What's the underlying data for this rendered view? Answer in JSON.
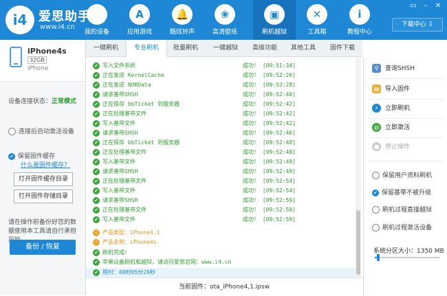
{
  "app": {
    "logo_text": "i4",
    "brand": "爱思助手",
    "url": "www.i4.cn",
    "download_center": "下载中心 ⇩"
  },
  "nav": [
    {
      "label": "我的设备",
      "icon": ""
    },
    {
      "label": "应用游戏",
      "icon": "A"
    },
    {
      "label": "酷炫铃声",
      "icon": "🔔"
    },
    {
      "label": "高清壁纸",
      "icon": "❀"
    },
    {
      "label": "刷机越狱",
      "icon": "▣"
    },
    {
      "label": "工具箱",
      "icon": "✕"
    },
    {
      "label": "教程中心",
      "icon": "i"
    }
  ],
  "device": {
    "name": "iPhone4s",
    "capacity": "32GB",
    "type": "iPhone"
  },
  "left": {
    "status_label": "设备连接状态：",
    "status_value": "正常模式",
    "auto_activate": "连接后自动激活设备",
    "keep_cache": "保留固件缓存",
    "what_cache": "什么是固件缓存？",
    "open_cache_dir": "打开固件缓存目录",
    "open_store_dir": "打开固件存储目录",
    "warning": "请在操作前备份好您的数据使用本工具请自行承担风险",
    "backup": "备份 / 恢复"
  },
  "tabs": [
    "一键刷机",
    "专业刷机",
    "批量刷机",
    "一键越狱",
    "高级功能",
    "其他工具",
    "固件下载"
  ],
  "log": [
    {
      "kind": "ok",
      "text": "写入文件系统",
      "status": "成功！ [09:51:34]"
    },
    {
      "kind": "ok",
      "text": "正在发送 KernelCache",
      "status": "成功！ [09:52:26]"
    },
    {
      "kind": "ok",
      "text": "正在发送 NORData",
      "status": "成功！ [09:52:28]"
    },
    {
      "kind": "ok",
      "text": "请求基带SHSH",
      "status": "成功！ [09:52:40]"
    },
    {
      "kind": "ok",
      "text": "正在保存 bbTicket 到服务器",
      "status": "成功！ [09:52:42]"
    },
    {
      "kind": "ok",
      "text": "正在处理基带文件",
      "status": "成功！ [09:52:42]"
    },
    {
      "kind": "ok",
      "text": "写入基带文件",
      "status": "成功！ [09:52:42]"
    },
    {
      "kind": "ok",
      "text": "请求基带SHSH",
      "status": "成功！ [09:52:46]"
    },
    {
      "kind": "ok",
      "text": "正在保存 bbTicket 到服务器",
      "status": "成功！ [09:52:48]"
    },
    {
      "kind": "ok",
      "text": "正在处理基带文件",
      "status": "成功！ [09:52:48]"
    },
    {
      "kind": "ok",
      "text": "写入基带文件",
      "status": "成功！ [09:52:49]"
    },
    {
      "kind": "ok",
      "text": "请求基带SHSH",
      "status": "成功！ [09:52:49]"
    },
    {
      "kind": "ok",
      "text": "正在处理基带文件",
      "status": "成功！ [09:52:54]"
    },
    {
      "kind": "ok",
      "text": "写入基带文件",
      "status": "成功！ [09:52:54]"
    },
    {
      "kind": "ok",
      "text": "请求基带SHSH",
      "status": "成功！ [09:52:59]"
    },
    {
      "kind": "ok",
      "text": "正在处理基带文件",
      "status": "成功！ [09:52:59]"
    },
    {
      "kind": "ok",
      "text": "写入基带文件",
      "status": "成功！ [09:52:59]"
    },
    {
      "kind": "info",
      "text": "产品类型：iPhone4,1",
      "status": ""
    },
    {
      "kind": "info",
      "text": "产品名称：iPhone4s",
      "status": ""
    },
    {
      "kind": "ok",
      "text": "刷机完成！",
      "status": ""
    },
    {
      "kind": "ok",
      "text": "苹果设备刷机和越狱，请访问爱思官网：www.i4.cn",
      "status": ""
    },
    {
      "kind": "time",
      "text": "用时：00时05分20秒",
      "status": ""
    }
  ],
  "footer": {
    "firmware": "当前固件：ota_iPhone4,1.ipsw"
  },
  "right": {
    "query_shsh": "查询SHSH",
    "import_fw": "导入固件",
    "flash_now": "立即刷机",
    "activate_now": "立即激活",
    "stop": "停止操作",
    "opt_keep_data": "保留用户资料刷机",
    "opt_keep_baseband": "保留基带不被升级",
    "opt_jailbreak": "刷机过程直接越狱",
    "opt_activate": "刷机过程激活设备",
    "partition": "系统分区大小：1350 MB",
    "partition_fraction": 0.05
  },
  "colors": {
    "accent": "#1e88d6",
    "success": "#2f9e2f",
    "info": "#e0961b"
  }
}
